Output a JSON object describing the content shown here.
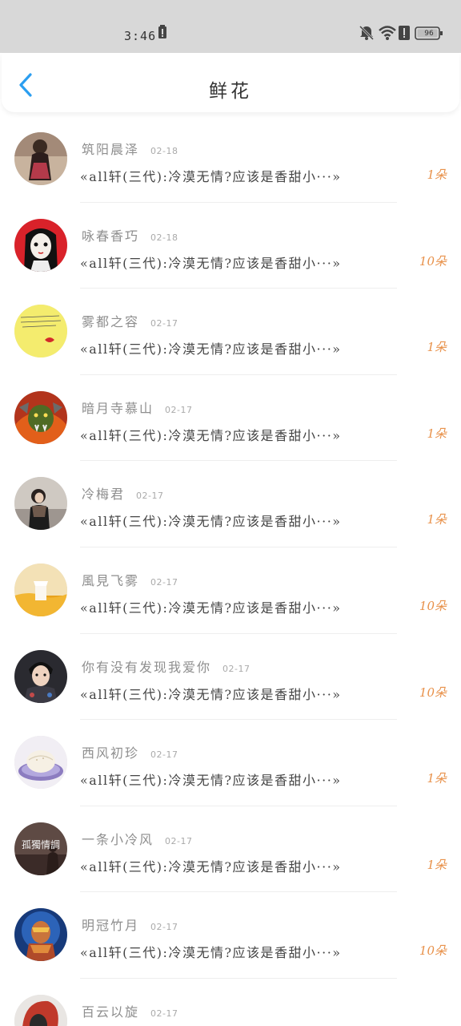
{
  "status": {
    "time": "3:46",
    "battery": "96",
    "icons": [
      "battery-saver-icon",
      "mute-bell-icon",
      "wifi-icon",
      "alert-icon",
      "battery-icon"
    ]
  },
  "header": {
    "title": "鲜花",
    "back_icon": "chevron-left-icon",
    "accent": "#2b9ef0"
  },
  "items": [
    {
      "name": "筑阳晨泽",
      "date": "02-18",
      "title": "«all轩(三代):冷漠无情?应该是香甜小···»",
      "count": "1朵",
      "avatar_icon": "avatar-girl-photo"
    },
    {
      "name": "咏春香巧",
      "date": "02-18",
      "title": "«all轩(三代):冷漠无情?应该是香甜小···»",
      "count": "10朵",
      "avatar_icon": "avatar-anime-red"
    },
    {
      "name": "雾都之容",
      "date": "02-17",
      "title": "«all轩(三代):冷漠无情?应该是香甜小···»",
      "count": "1朵",
      "avatar_icon": "avatar-yellow-lips"
    },
    {
      "name": "暗月寺慕山",
      "date": "02-17",
      "title": "«all轩(三代):冷漠无情?应该是香甜小···»",
      "count": "1朵",
      "avatar_icon": "avatar-orc-warrior"
    },
    {
      "name": "冷梅君",
      "date": "02-17",
      "title": "«all轩(三代):冷漠无情?应该是香甜小···»",
      "count": "1朵",
      "avatar_icon": "avatar-scarf-girl"
    },
    {
      "name": "風見飞雾",
      "date": "02-17",
      "title": "«all轩(三代):冷漠无情?应该是香甜小···»",
      "count": "10朵",
      "avatar_icon": "avatar-autumn-field"
    },
    {
      "name": "你有没有发现我爱你",
      "date": "02-17",
      "title": "«all轩(三代):冷漠无情?应该是香甜小···»",
      "count": "10朵",
      "avatar_icon": "avatar-young-man"
    },
    {
      "name": "西风初珍",
      "date": "02-17",
      "title": "«all轩(三代):冷漠无情?应该是香甜小···»",
      "count": "1朵",
      "avatar_icon": "avatar-bun-plate"
    },
    {
      "name": "一条小冷风",
      "date": "02-17",
      "title": "«all轩(三代):冷漠无情?应该是香甜小···»",
      "count": "1朵",
      "avatar_icon": "avatar-lonely-text",
      "avatar_text": "孤獨情調"
    },
    {
      "name": "明冠竹月",
      "date": "02-17",
      "title": "«all轩(三代):冷漠无情?应该是香甜小···»",
      "count": "10朵",
      "avatar_icon": "avatar-armored-hero"
    },
    {
      "name": "百云以旋",
      "date": "02-17",
      "title": "",
      "count": "",
      "avatar_icon": "avatar-red-hair"
    }
  ]
}
